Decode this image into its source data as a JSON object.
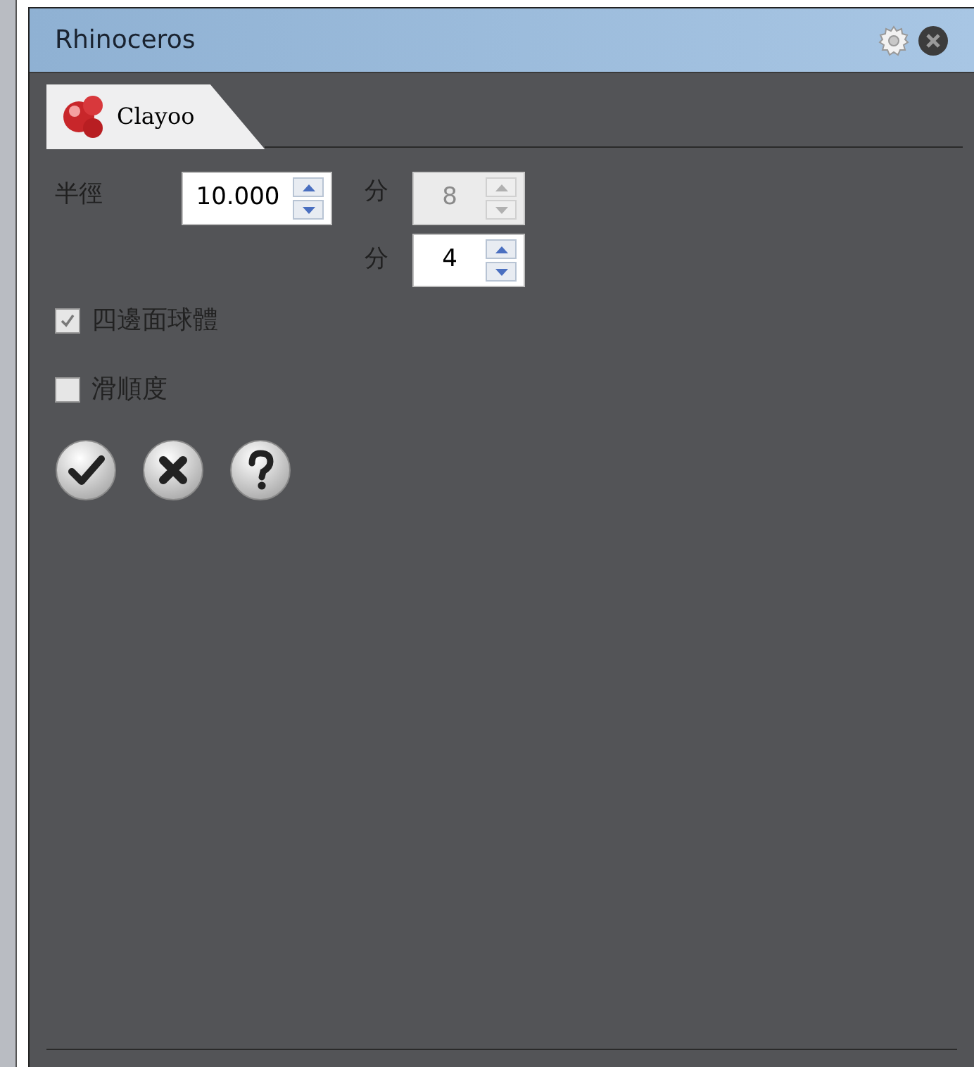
{
  "window": {
    "title": "Rhinoceros"
  },
  "tabs": [
    {
      "label": "Clayoo",
      "selected": true
    }
  ],
  "fields": [
    {
      "label": "半徑",
      "value": "10.000",
      "disabled": false
    },
    {
      "label": "分",
      "value": "8",
      "disabled": true
    },
    {
      "label": "分",
      "value": "4",
      "disabled": false
    }
  ],
  "checkboxes": [
    {
      "label": "四邊面球體",
      "checked": true
    },
    {
      "label": "滑順度",
      "checked": false
    }
  ],
  "actions": [
    {
      "kind": "ok"
    },
    {
      "kind": "cancel"
    },
    {
      "kind": "help"
    }
  ]
}
